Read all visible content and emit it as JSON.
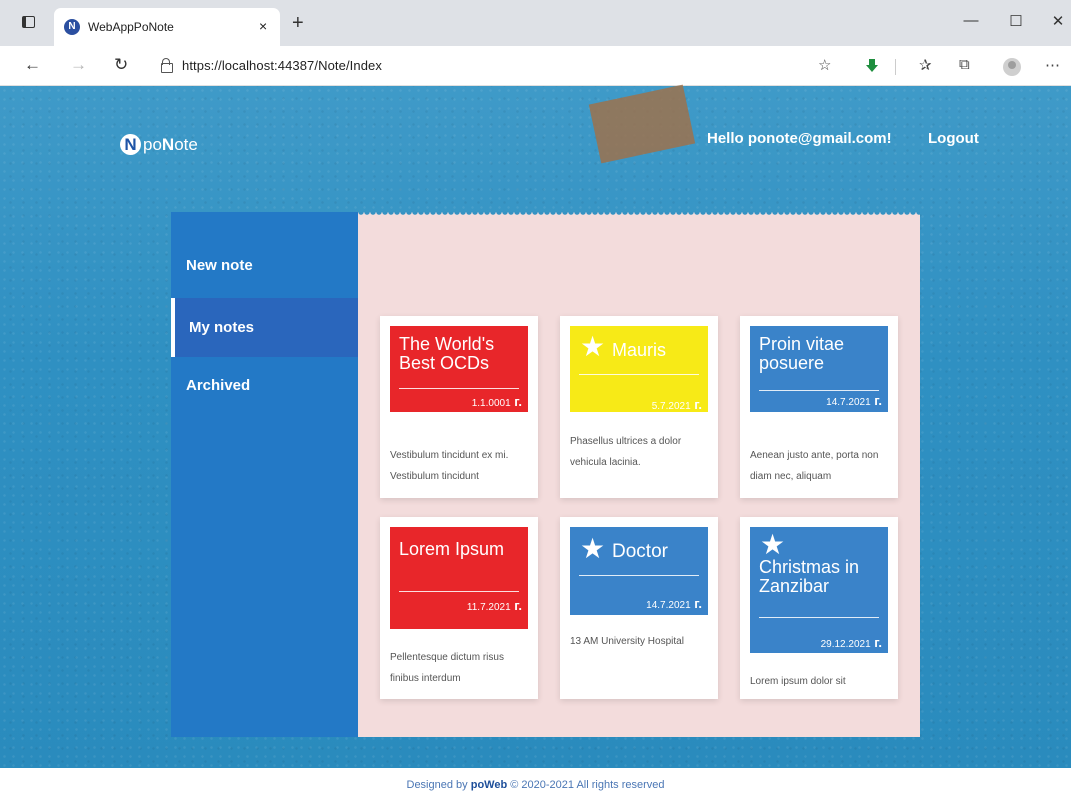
{
  "browser": {
    "tab_title": "WebAppPoNote",
    "favicon_letter": "N",
    "tab_close": "×",
    "new_tab": "+",
    "url": "https://localhost:44387/Note/Index",
    "window_controls": {
      "minimize": "—",
      "maximize": "☐",
      "close": "✕"
    },
    "nav": {
      "back": "←",
      "forward": "→",
      "refresh": "↻"
    },
    "toolbar_icons": [
      "star-add-icon",
      "download-icon",
      "favorites-icon",
      "collections-icon",
      "profile-icon",
      "more-icon"
    ],
    "toolbar_glyphs": {
      "star_add": "☆",
      "favorites": "✰",
      "collections": "⧉",
      "more": "⋯"
    }
  },
  "header": {
    "logo_letter": "N",
    "logo_prefix": "po",
    "logo_bold": "N",
    "logo_suffix": "ote",
    "greeting": "Hello ponote@gmail.com!",
    "logout": "Logout"
  },
  "sidebar": {
    "items": [
      {
        "label": "New note",
        "active": false
      },
      {
        "label": "My notes",
        "active": true
      },
      {
        "label": "Archived",
        "active": false
      }
    ]
  },
  "notes": [
    {
      "title": "The World's Best OCDs",
      "date": "1.1.0001",
      "text": "Vestibulum tincidunt ex mi. Vestibulum tincidunt",
      "color": "red",
      "starred": false
    },
    {
      "title": "Mauris",
      "date": "5.7.2021",
      "text": "Phasellus ultrices a dolor vehicula lacinia.",
      "color": "yellow",
      "starred": true
    },
    {
      "title": "Proin vitae posuere",
      "date": "14.7.2021",
      "text": "Aenean justo ante, porta non diam nec, aliquam",
      "color": "blue",
      "starred": false
    },
    {
      "title": "Lorem Ipsum",
      "date": "11.7.2021",
      "text": "Pellentesque dictum risus finibus interdum",
      "color": "red",
      "starred": false
    },
    {
      "title": "Doctor",
      "date": "14.7.2021",
      "text": "13 AM University Hospital",
      "color": "blue",
      "starred": true
    },
    {
      "title": "Christmas in Zanzibar",
      "date": "29.12.2021",
      "text": "Lorem ipsum dolor sit",
      "color": "blue",
      "starred": true
    }
  ],
  "colors": {
    "red": "#e8262a",
    "yellow": "#f7ea17",
    "blue": "#3a83c9",
    "sidebar": "#2379c6",
    "board": "#f3dcdc"
  },
  "footer": {
    "prefix": "Designed by",
    "brand": "poWeb",
    "suffix": "© 2020-2021 All rights reserved"
  }
}
